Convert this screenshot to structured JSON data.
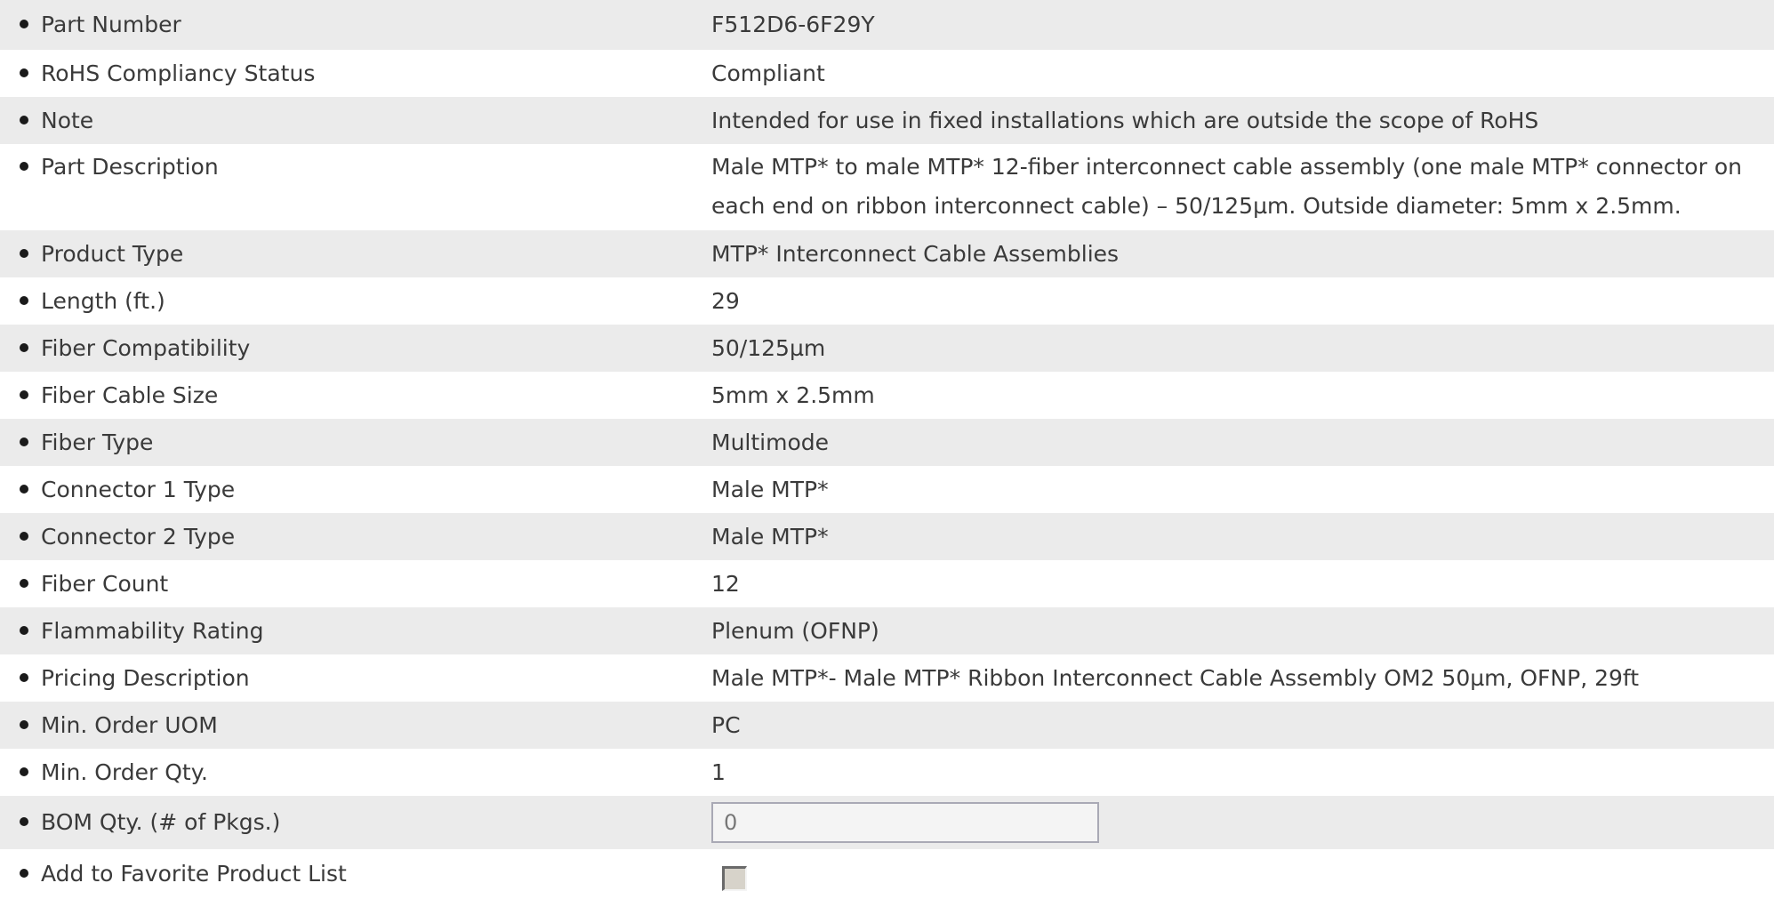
{
  "specs": {
    "part_number": {
      "label": "Part Number",
      "value": "F512D6-6F29Y"
    },
    "rohs": {
      "label": "RoHS Compliancy Status",
      "value": "Compliant"
    },
    "note": {
      "label": "Note",
      "value": "Intended for use in fixed installations which are outside the scope of RoHS"
    },
    "part_description": {
      "label": "Part Description",
      "value_line1": "Male MTP* to male MTP* 12-fiber interconnect cable assembly (one male MTP* connector on",
      "value_line2": "each end on ribbon interconnect cable) – 50/125µm. Outside diameter: 5mm x 2.5mm."
    },
    "product_type": {
      "label": "Product Type",
      "value": "MTP* Interconnect Cable Assemblies"
    },
    "length": {
      "label": "Length (ft.)",
      "value": "29"
    },
    "fiber_compatibility": {
      "label": "Fiber Compatibility",
      "value": "50/125µm"
    },
    "fiber_cable_size": {
      "label": "Fiber Cable Size",
      "value": "5mm x 2.5mm"
    },
    "fiber_type": {
      "label": "Fiber Type",
      "value": "Multimode"
    },
    "connector1": {
      "label": "Connector 1 Type",
      "value": "Male MTP*"
    },
    "connector2": {
      "label": "Connector 2 Type",
      "value": "Male MTP*"
    },
    "fiber_count": {
      "label": "Fiber Count",
      "value": "12"
    },
    "flammability": {
      "label": "Flammability Rating",
      "value": "Plenum (OFNP)"
    },
    "pricing_description": {
      "label": "Pricing Description",
      "value": "Male MTP*- Male MTP* Ribbon Interconnect Cable Assembly OM2 50µm, OFNP, 29ft"
    },
    "min_order_uom": {
      "label": "Min. Order UOM",
      "value": "PC"
    },
    "min_order_qty": {
      "label": "Min. Order Qty.",
      "value": "1"
    },
    "bom_qty": {
      "label": "BOM Qty. (# of Pkgs.)",
      "value": "0"
    },
    "favorite": {
      "label": "Add to Favorite Product List",
      "checked": false
    }
  },
  "colors": {
    "row_shade": "#ebebeb",
    "row_plain": "#ffffff",
    "text": "#3a3a3a"
  }
}
